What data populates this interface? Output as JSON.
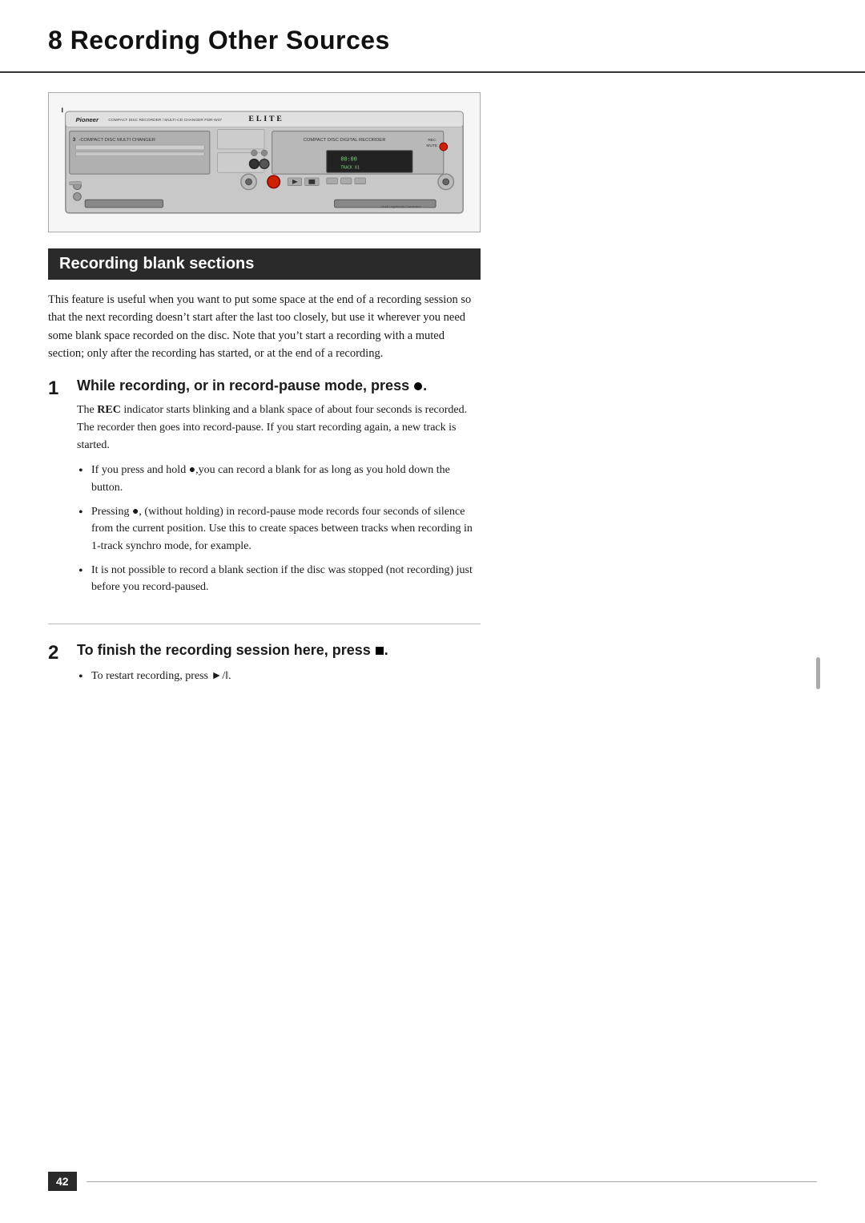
{
  "page": {
    "chapter_title": "8 Recording Other Sources",
    "page_number": "42"
  },
  "device_image": {
    "alt": "Pioneer PDR-W37 CD Recorder device front panel image"
  },
  "section": {
    "heading": "Recording blank sections",
    "intro_text": "This feature is useful when you want to put some space at the end of a recording session so that the next recording doesn’t start after the last too closely, but use it wherever you need some blank space recorded on the disc. Note that you’t start a recording with a muted section; only after the recording has started, or at the end of a recording."
  },
  "steps": [
    {
      "number": "1",
      "title": "While recording, or in record-pause mode, press",
      "title_icon": "circle",
      "desc": "The REC indicator starts blinking and a blank space of about four seconds is recorded. The recorder then goes into record-pause. If you start recording again, a new track is started.",
      "desc_bold": "REC",
      "bullets": [
        "If you press and hold ●,you can record a blank for as long as you hold down the button.",
        "Pressing ●, (without holding) in record-pause mode records four seconds of silence from the current position. Use this to create spaces between tracks when recording in 1-track synchro mode, for example.",
        "It is not possible to record a blank section if the disc was stopped (not recording) just before you record-paused."
      ]
    },
    {
      "number": "2",
      "title": "To finish the recording session here, press",
      "title_icon": "square",
      "bullets": [
        "To restart recording, press ►/‖."
      ]
    }
  ]
}
